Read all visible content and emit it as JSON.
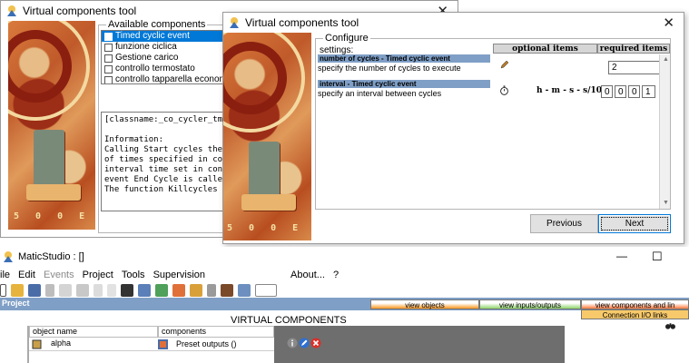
{
  "back_window": {
    "title": "Virtual components tool",
    "close_glyph": "✕",
    "available_legend": "Available components",
    "components": [
      {
        "label": "Timed cyclic event",
        "selected": true
      },
      {
        "label": "funzione ciclica",
        "selected": false
      },
      {
        "label": "Gestione carico",
        "selected": false
      },
      {
        "label": "controllo termostato",
        "selected": false
      },
      {
        "label": "controllo tapparella economica",
        "selected": false
      }
    ],
    "info_lines": [
      "[classname:_co_cycler_tmp",
      "",
      "Information:",
      "Calling Start cycles the",
      "of times specified in con",
      "interval time set in conf",
      "event End Cycle is called",
      "The function Killcycles c"
    ]
  },
  "front_window": {
    "title": "Virtual components tool",
    "close_glyph": "✕",
    "configure_legend": "Configure",
    "settings_label": "settings:",
    "col_optional": "optional items",
    "col_required": "required items",
    "items": [
      {
        "title": "number of cycles - Timed cyclic event",
        "description": "specify the number of cycles to execute",
        "icon": "pencil-icon",
        "required_value": "2"
      },
      {
        "title": "interval - Timed cyclic event",
        "description": "specify an interval between cycles",
        "icon": "stopwatch-icon",
        "optional_text": "h - m - s - s/10",
        "required_values": [
          "0",
          "0",
          "0",
          "1"
        ]
      }
    ],
    "previous_label": "Previous",
    "next_label": "Next"
  },
  "matic": {
    "title": "MaticStudio : []",
    "minimize_glyph": "—",
    "maximize_glyph": "☐",
    "menu": [
      "ile",
      "Edit",
      "Events",
      "Project",
      "Tools",
      "Supervision",
      "About...",
      "?"
    ],
    "project_label": "Project",
    "tabs": {
      "view_objects": "view objects",
      "view_io": "view inputs/outputs",
      "view_components": "view components and lin",
      "connection_links": "Connection I/O links"
    },
    "section_title": "VIRTUAL COMPONENTS",
    "col_object": "object name",
    "col_components": "components",
    "row_object": "alpha",
    "row_component": "Preset outputs ()",
    "colors": {
      "objects_tab": "#f7941d",
      "io_tab": "#8ed46a",
      "components_tab": "#ff7a3d",
      "project_bar": "#7f9fc6"
    }
  }
}
